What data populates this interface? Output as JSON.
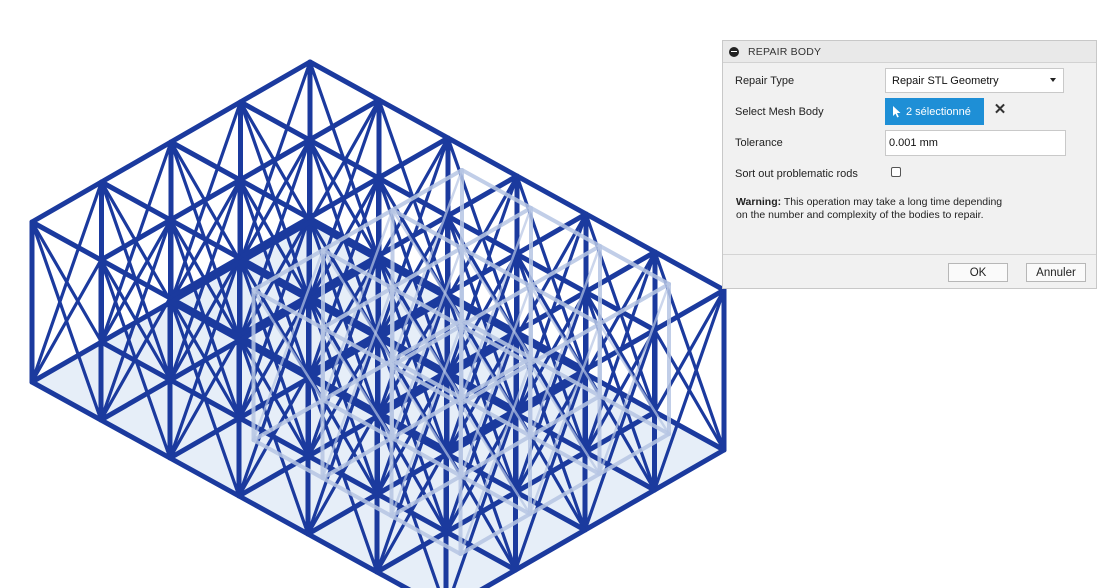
{
  "dialog": {
    "title": "REPAIR BODY",
    "repair_type": {
      "label": "Repair Type",
      "value": "Repair STL Geometry"
    },
    "select_mesh_body": {
      "label": "Select Mesh Body",
      "value": "2 sélectionné"
    },
    "tolerance": {
      "label": "Tolerance",
      "value": "0.001 mm"
    },
    "sort_rods": {
      "label": "Sort out problematic rods",
      "checked": false
    },
    "warning": {
      "bold": "Warning:",
      "line1": " This operation may take a long time depending",
      "line2": "on the number and complexity of the bodies to repair."
    },
    "ok_label": "OK",
    "cancel_label": "Annuler"
  },
  "viewport": {
    "colors": {
      "lattice": "#1b3a9e",
      "ghost": "#b7c6e4",
      "shadow": "#e6eef8"
    }
  }
}
